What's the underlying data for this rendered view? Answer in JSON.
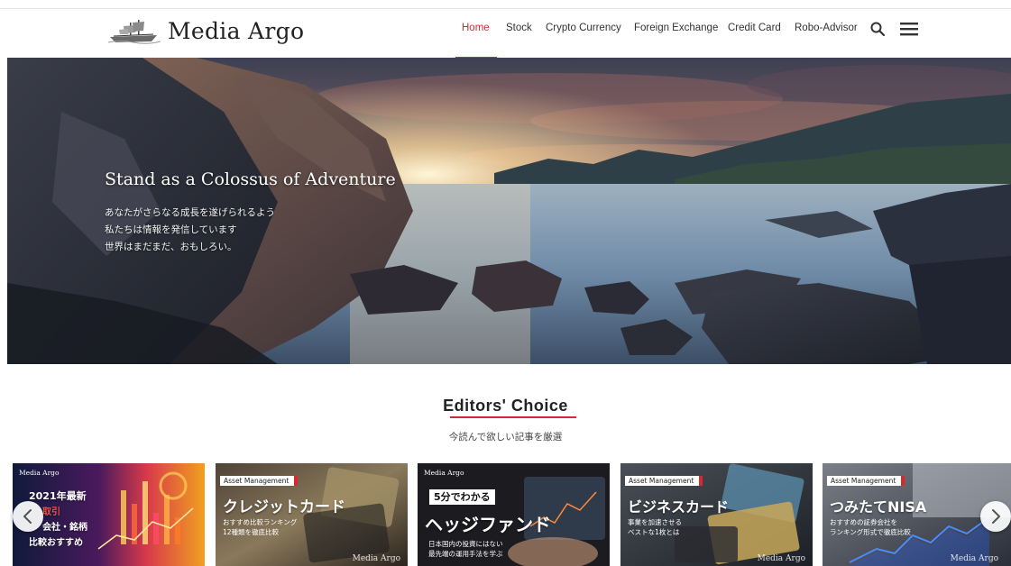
{
  "brand": {
    "name": "Media Argo"
  },
  "nav": {
    "items": [
      {
        "label": "Home",
        "active": true
      },
      {
        "label": "Stock",
        "active": false
      },
      {
        "label": "Crypto Currency",
        "active": false
      },
      {
        "label": "Foreign Exchange",
        "active": false
      },
      {
        "label": "Credit Card",
        "active": false
      },
      {
        "label": "Robo-Advisor",
        "active": false
      }
    ],
    "icons": [
      "search-icon",
      "hamburger-menu-icon"
    ]
  },
  "hero": {
    "title": "Stand as a Colossus of Adventure",
    "lines": [
      "あなたがさらなる成長を遂げられるよう",
      "私たちは情報を発信しています",
      "世界はまだまだ、おもしろい。"
    ]
  },
  "editors_choice": {
    "title": "Editors' Choice",
    "subtitle": "今読んで欲しい記事を厳選"
  },
  "cards": [
    {
      "brand": "Media Argo",
      "headline_lines": [
        "2021年最新",
        "取引",
        "会社・銘柄",
        "比較おすすめ"
      ]
    },
    {
      "tag": "Asset Management",
      "headline": "クレジットカード",
      "lines": [
        "おすすめ比較ランキング",
        "12種類を徹底比較"
      ],
      "watermark": "Media Argo"
    },
    {
      "brand": "Media Argo",
      "badge": "5分でわかる",
      "headline": "ヘッジファンド",
      "lines": [
        "日本国内の投資にはない",
        "最先端の運用手法を学ぶ"
      ]
    },
    {
      "tag": "Asset Management",
      "headline": "ビジネスカード",
      "lines": [
        "事業を加速させる",
        "ベストな1枚とは"
      ],
      "watermark": "Media Argo"
    },
    {
      "tag": "Asset Management",
      "headline": "つみたてNISA",
      "lines": [
        "おすすめの証券会社を",
        "ランキング形式で徹底比較"
      ],
      "watermark": "Media Argo"
    }
  ],
  "carousel": {
    "icons": [
      "chevron-left-icon",
      "chevron-right-icon"
    ]
  },
  "colors": {
    "accent": "#d9282f",
    "text": "#222222"
  }
}
